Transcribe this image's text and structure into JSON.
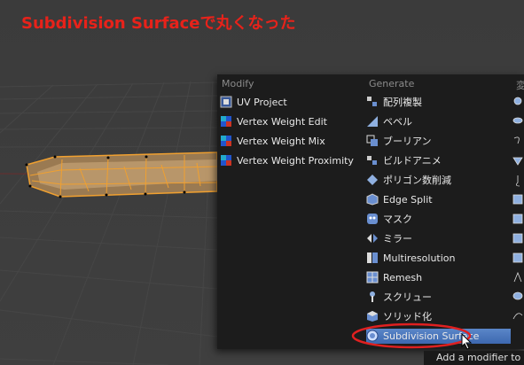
{
  "annotation": {
    "title": "Subdivision Surfaceで丸くなった",
    "color": "#e8221a"
  },
  "menu": {
    "modify": {
      "header": "Modify",
      "items": [
        {
          "label": "UV Project",
          "icon": "uv-project-icon"
        },
        {
          "label": "Vertex Weight Edit",
          "icon": "vertex-weight-icon"
        },
        {
          "label": "Vertex Weight Mix",
          "icon": "vertex-weight-icon"
        },
        {
          "label": "Vertex Weight Proximity",
          "icon": "vertex-weight-icon"
        }
      ]
    },
    "generate": {
      "header": "Generate",
      "items": [
        {
          "label": "配列複製",
          "icon": "array-icon"
        },
        {
          "label": "ベベル",
          "icon": "bevel-icon"
        },
        {
          "label": "ブーリアン",
          "icon": "boolean-icon"
        },
        {
          "label": "ビルドアニメ",
          "icon": "build-icon"
        },
        {
          "label": "ポリゴン数削減",
          "icon": "decimate-icon"
        },
        {
          "label": "Edge Split",
          "icon": "edge-split-icon"
        },
        {
          "label": "マスク",
          "icon": "mask-icon"
        },
        {
          "label": "ミラー",
          "icon": "mirror-icon"
        },
        {
          "label": "Multiresolution",
          "icon": "multires-icon"
        },
        {
          "label": "Remesh",
          "icon": "remesh-icon"
        },
        {
          "label": "スクリュー",
          "icon": "screw-icon"
        },
        {
          "label": "ソリッド化",
          "icon": "solidify-icon"
        },
        {
          "label": "Subdivision Surface",
          "icon": "subsurf-icon",
          "highlighted": true
        }
      ]
    },
    "deform": {
      "header": "変"
    }
  },
  "tooltip": {
    "text": "Add a modifier to th"
  },
  "colors": {
    "highlight": "#4a78c0",
    "menu_bg": "#1c1c1c",
    "mesh_orange": "#f0a030"
  }
}
